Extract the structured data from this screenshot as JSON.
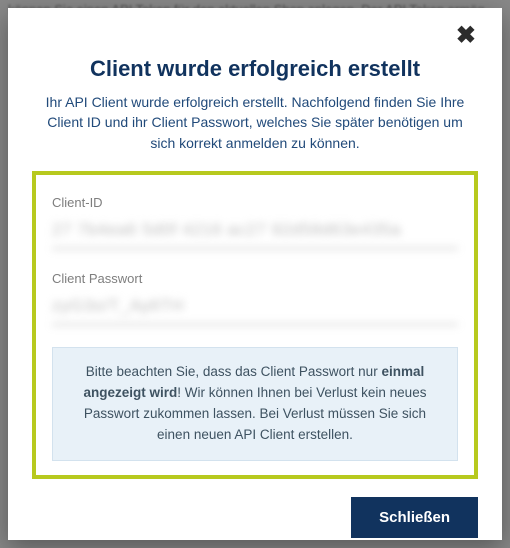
{
  "backdrop": "können Sie einen API Token für den aktuellen Shop anlegen. Der API Token ermög",
  "modal": {
    "title": "Client wurde erfolgreich erstellt",
    "description": "Ihr API Client wurde erfolgreich erstellt. Nachfolgend finden Sie Ihre Client ID und ihr Client Passwort, welches Sie später benötigen um sich korrekt anmelden zu können.",
    "client_id_label": "Client-ID",
    "client_id_value": "27 7b4ea6 5d0f 4216 ac27 92d58d63e435a",
    "client_password_label": "Client Passwort",
    "client_password_value": "zyG3o/T_Ay6TH",
    "notice_pre": "Bitte beachten Sie, dass das Client Passwort nur ",
    "notice_bold": "einmal angezeigt wird",
    "notice_post": "! Wir können Ihnen bei Verlust kein neues Passwort zukommen lassen. Bei Verlust müssen Sie sich einen neuen API Client erstellen.",
    "close_button": "Schließen"
  }
}
